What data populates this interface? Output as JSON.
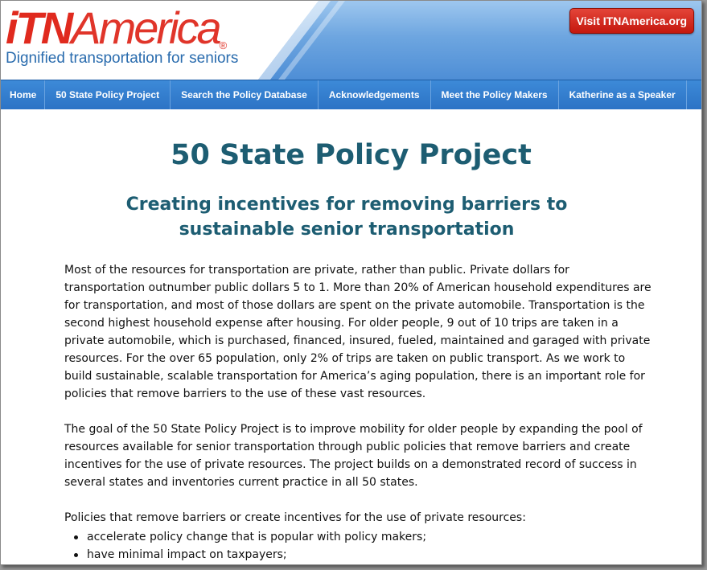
{
  "header": {
    "logo": {
      "itn": "iTN",
      "america": "America",
      "reg": "®"
    },
    "tagline": "Dignified transportation for seniors",
    "visit_button": "Visit ITNAmerica.org"
  },
  "nav": {
    "items": [
      {
        "label": "Home"
      },
      {
        "label": "50 State Policy Project"
      },
      {
        "label": "Search the Policy Database"
      },
      {
        "label": "Acknowledgements"
      },
      {
        "label": "Meet the Policy Makers"
      },
      {
        "label": "Katherine as a Speaker"
      }
    ]
  },
  "main": {
    "title": "50 State Policy Project",
    "subtitle": "Creating incentives for removing barriers to sustainable senior transportation",
    "paragraphs": [
      "Most of the resources for transportation are private, rather than public. Private dollars for transportation outnumber public dollars 5 to 1. More than 20% of American household expenditures are for transportation, and most of those dollars are spent on the private automobile. Transportation is the second highest household expense after housing. For older people, 9 out of 10 trips are taken in a private automobile, which is purchased, financed, insured, fueled, maintained and garaged with private resources. For the over 65 population, only 2% of trips are taken on public transport. As we work to build sustainable, scalable transportation for America’s aging population, there is an important role for policies that remove barriers to the use of these vast resources.",
      "The goal of the 50 State Policy Project is to improve mobility for older people by expanding the pool of resources available for senior transportation through public policies that remove barriers and create incentives for the use of private resources. The project builds on a demonstrated record of success in several states and inventories current practice in all 50 states.",
      "Policies that remove barriers or create incentives for the use of private resources:"
    ],
    "bullets": [
      "accelerate policy change that is popular with policy makers;",
      "have minimal impact on taxpayers;"
    ]
  },
  "colors": {
    "brand_red": "#e02a1e",
    "nav_blue": "#2c73c5",
    "heading_teal": "#1d5d72",
    "tagline_blue": "#2a6cae"
  }
}
